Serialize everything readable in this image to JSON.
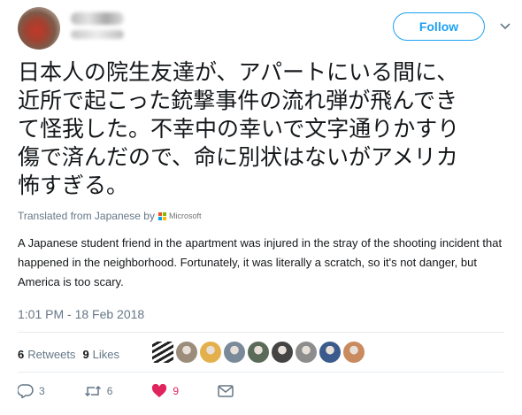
{
  "header": {
    "follow_label": "Follow"
  },
  "tweet": {
    "lines": [
      "日本人の院生友達が、アパートにいる間に、",
      "近所で起こった銃撃事件の流れ弾が飛んでき",
      "て怪我した。不幸中の幸いで文字通りかすり",
      "傷で済んだので、命に別状はないがアメリカ",
      "怖すぎる。"
    ],
    "translated_from": "Translated from Japanese by",
    "translator": "Microsoft",
    "translation": "A Japanese student friend in the apartment was injured in the stray of the shooting incident that happened in the neighborhood. Fortunately, it was literally a scratch, so it's not danger, but America is too scary.",
    "timestamp": "1:01 PM - 18 Feb 2018"
  },
  "stats": {
    "retweets_count": "6",
    "retweets_label": "Retweets",
    "likes_count": "9",
    "likes_label": "Likes"
  },
  "likers": [
    {
      "color": "#222222"
    },
    {
      "color": "#9b8c7c"
    },
    {
      "color": "#e3b04b"
    },
    {
      "color": "#7a8a99"
    },
    {
      "color": "#5b6b5a"
    },
    {
      "color": "#444444"
    },
    {
      "color": "#8d8d8d"
    },
    {
      "color": "#3b5b8c"
    },
    {
      "color": "#c98a5e"
    }
  ],
  "actions": {
    "reply_count": "3",
    "retweet_count": "6",
    "like_count": "9"
  },
  "colors": {
    "accent": "#1da1f2",
    "like": "#e0245e",
    "muted": "#657786"
  }
}
